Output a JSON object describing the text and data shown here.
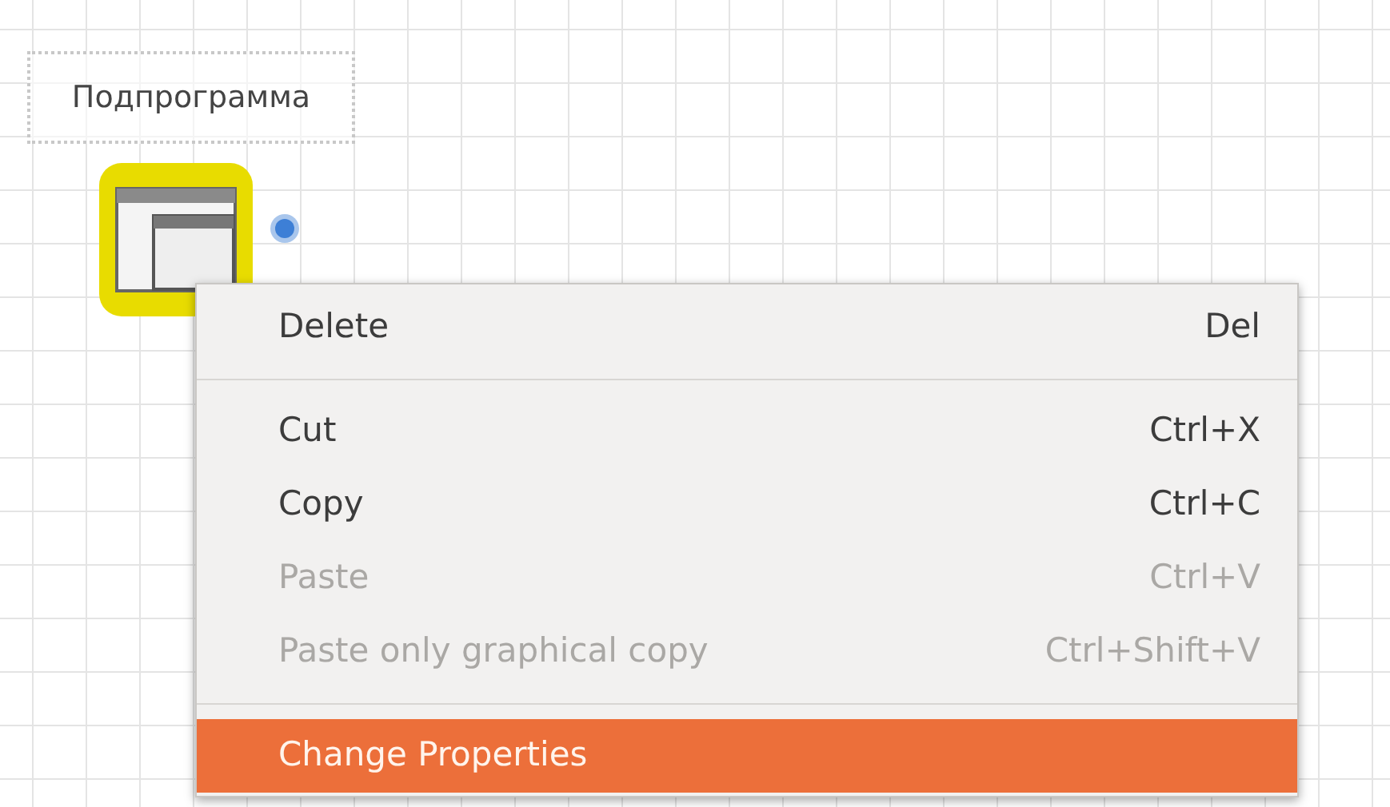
{
  "canvas": {
    "block_label": "Подпрограмма",
    "block": {
      "selected": true
    }
  },
  "context_menu": {
    "items": [
      {
        "kind": "item",
        "label": "Delete",
        "shortcut": "Del",
        "disabled": false,
        "selected": false
      },
      {
        "kind": "separator"
      },
      {
        "kind": "item",
        "label": "Cut",
        "shortcut": "Ctrl+X",
        "disabled": false,
        "selected": false
      },
      {
        "kind": "item",
        "label": "Copy",
        "shortcut": "Ctrl+C",
        "disabled": false,
        "selected": false
      },
      {
        "kind": "item",
        "label": "Paste",
        "shortcut": "Ctrl+V",
        "disabled": true,
        "selected": false
      },
      {
        "kind": "item",
        "label": "Paste only graphical copy",
        "shortcut": "Ctrl+Shift+V",
        "disabled": true,
        "selected": false
      },
      {
        "kind": "separator"
      },
      {
        "kind": "item",
        "label": "Change Properties",
        "selected": true
      }
    ]
  }
}
